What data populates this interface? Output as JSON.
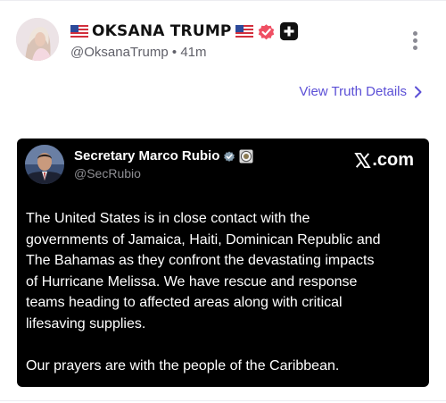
{
  "post": {
    "display_name": "OKSANA TRUMP",
    "handle": "@OksanaTrump",
    "separator": "•",
    "time_ago": "41m",
    "view_details_label": "View Truth Details",
    "icons": [
      "us-flag-icon",
      "verified-badge-icon",
      "plus-badge-icon",
      "more-vertical-icon",
      "chevron-right-icon"
    ]
  },
  "embed": {
    "author_name": "Secretary Marco Rubio",
    "author_handle": "@SecRubio",
    "source_label": ".com",
    "source_icon": "x-logo-icon",
    "body_lines": [
      "The United States is in close contact with the",
      "governments of Jamaica, Haiti, Dominican Republic and",
      "The Bahamas as they confront the devastating impacts",
      "of Hurricane Melissa.  We have rescue and response",
      "teams heading to affected areas along with critical",
      "lifesaving supplies."
    ],
    "closing_line": "Our prayers are with the people of the Caribbean."
  },
  "colors": {
    "accent_link": "#5b4fd6",
    "verified_badge": "#ef4f63",
    "plus_badge": "#111111",
    "embed_background": "#000000"
  }
}
